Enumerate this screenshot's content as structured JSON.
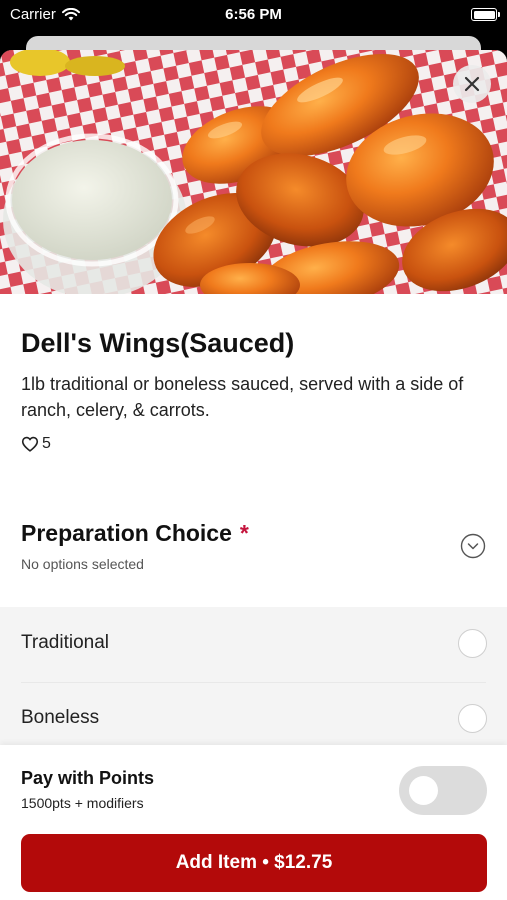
{
  "status_bar": {
    "carrier": "Carrier",
    "time": "6:56 PM",
    "wifi_icon": "wifi-icon",
    "battery_icon": "battery-icon"
  },
  "item": {
    "photo": "buffalo-wings-photo",
    "title": "Dell's Wings(Sauced)",
    "description": "1lb traditional or boneless sauced, served with a side of ranch, celery, & carrots.",
    "likes": "5",
    "like_icon": "heart-icon",
    "close_icon": "close-icon"
  },
  "preparation": {
    "title": "Preparation Choice",
    "required_mark": "*",
    "subtitle": "No options selected",
    "chevron_icon": "chevron-down-icon",
    "options": [
      {
        "label": "Traditional",
        "selected": false
      },
      {
        "label": "Boneless",
        "selected": false
      }
    ]
  },
  "points": {
    "title": "Pay with Points",
    "subtitle": "1500pts + modifiers",
    "enabled": false
  },
  "add_button": {
    "label": "Add Item • $12.75"
  },
  "colors": {
    "accent": "#b30a0a",
    "required_star": "#c4143c",
    "options_background": "#f4f4f4",
    "toggle_off": "#dcdcdc"
  }
}
